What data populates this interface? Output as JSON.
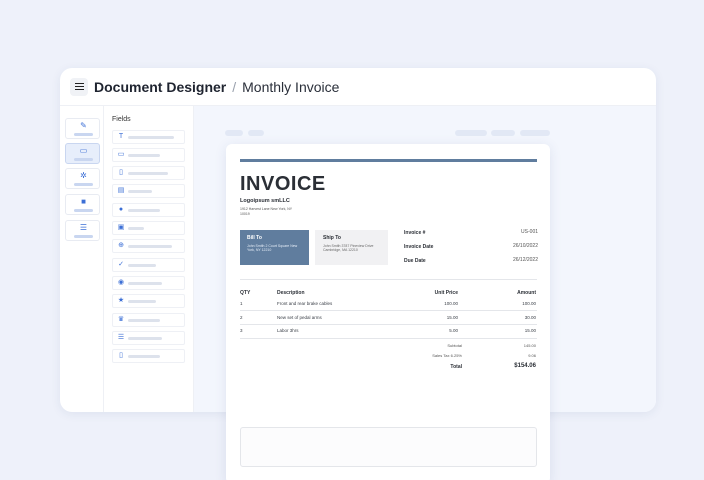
{
  "app": {
    "title": "Document Designer",
    "separator": "/",
    "document": "Monthly Invoice"
  },
  "sidebar": {
    "items": [
      {
        "icon": "brush-icon",
        "glyph": "✎"
      },
      {
        "icon": "folder-icon",
        "glyph": "▭"
      },
      {
        "icon": "gear-icon",
        "glyph": "✲"
      },
      {
        "icon": "lock-icon",
        "glyph": "■"
      },
      {
        "icon": "list-icon",
        "glyph": "☰"
      }
    ]
  },
  "fields": {
    "title": "Fields",
    "items": [
      {
        "icon": "text-icon",
        "glyph": "T"
      },
      {
        "icon": "calendar-icon",
        "glyph": "▭"
      },
      {
        "icon": "document-icon",
        "glyph": "▯"
      },
      {
        "icon": "table-icon",
        "glyph": "▤"
      },
      {
        "icon": "circle-icon",
        "glyph": "●"
      },
      {
        "icon": "image-icon",
        "glyph": "▣"
      },
      {
        "icon": "plus-circle-icon",
        "glyph": "⊕"
      },
      {
        "icon": "check-icon",
        "glyph": "✓"
      },
      {
        "icon": "user-icon",
        "glyph": "◉"
      },
      {
        "icon": "star-icon",
        "glyph": "★"
      },
      {
        "icon": "crown-icon",
        "glyph": "♛"
      },
      {
        "icon": "list-icon",
        "glyph": "☰"
      },
      {
        "icon": "page-icon",
        "glyph": "▯"
      }
    ]
  },
  "invoice": {
    "title": "INVOICE",
    "company": "Logoipsum smLLC",
    "company_address": "1912 Harvest Lane New York, NY 10019",
    "bill_to": {
      "heading": "Bill To",
      "address": "John Smith 2 Court Square New York, NY 12210"
    },
    "ship_to": {
      "heading": "Ship To",
      "address": "John Smith 3787 Pineview Drive Cambridge, MA 12210"
    },
    "meta": [
      {
        "label": "Invoice #",
        "value": "US-001"
      },
      {
        "label": "Invoice Date",
        "value": "26/10/2022"
      },
      {
        "label": "Due Date",
        "value": "26/12/2022"
      }
    ],
    "columns": {
      "qty": "QTY",
      "description": "Description",
      "unit_price": "Unit Price",
      "amount": "Amount"
    },
    "rows": [
      {
        "qty": "1",
        "description": "Front and rear brake cables",
        "unit_price": "100.00",
        "amount": "100.00"
      },
      {
        "qty": "2",
        "description": "New set of pedal arms",
        "unit_price": "15.00",
        "amount": "30.00"
      },
      {
        "qty": "3",
        "description": "Labor 3hrs",
        "unit_price": "5.00",
        "amount": "15.00"
      }
    ],
    "subtotal_label": "Subtotal",
    "subtotal": "145.00",
    "tax_label": "Sales Tax 6.25%",
    "tax": "9.06",
    "total_label": "Total",
    "total": "$154.06"
  },
  "colors": {
    "accent": "#607d9e",
    "canvas": "#f3f6fd",
    "icon": "#3c6fd6"
  }
}
